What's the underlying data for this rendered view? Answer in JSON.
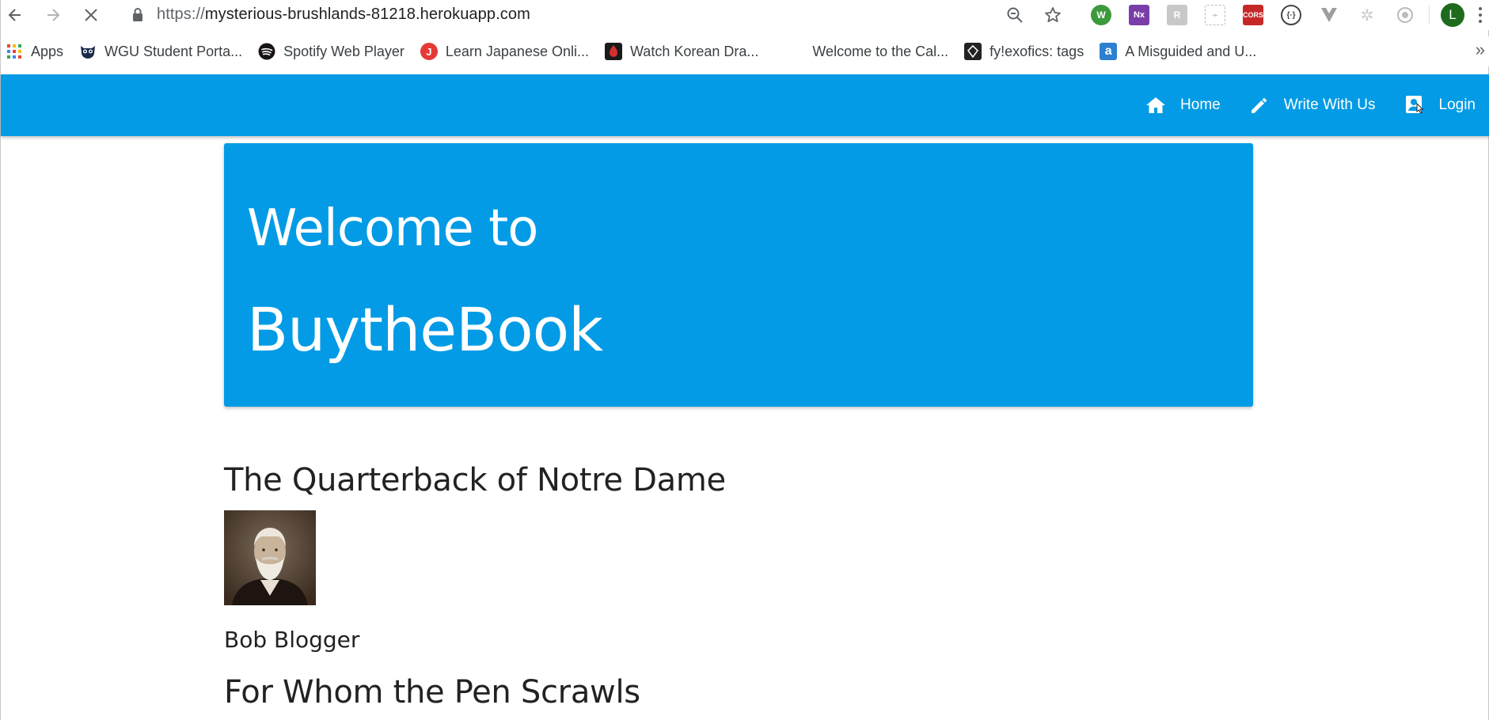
{
  "browser": {
    "url_scheme": "https://",
    "url_domain": "mysterious-brushlands-81218.herokuapp.com",
    "bookmarks": [
      {
        "label": "Apps",
        "icon": "apps-grid-icon"
      },
      {
        "label": "WGU Student Porta...",
        "icon": "owl-icon"
      },
      {
        "label": "Spotify Web Player",
        "icon": "spotify-icon"
      },
      {
        "label": "Learn Japanese Onli...",
        "icon": "japanese-site-icon"
      },
      {
        "label": "Watch Korean Dra...",
        "icon": "drama-site-icon"
      },
      {
        "label": "Welcome to the Cal...",
        "icon": ""
      },
      {
        "label": "fy!exofics: tags",
        "icon": "diamond-icon"
      },
      {
        "label": "A Misguided and U...",
        "icon": "a-letter-icon"
      }
    ],
    "avatar_letter": "L",
    "extension_labels": {
      "onenote": "Nx",
      "cors": "CORS"
    }
  },
  "nav": {
    "home": "Home",
    "write": "Write With Us",
    "login": "Login"
  },
  "hero": {
    "line1": "Welcome to",
    "line2": "BuytheBook"
  },
  "posts": [
    {
      "title": "The Quarterback of Notre Dame",
      "author": "Bob Blogger"
    },
    {
      "title": "For Whom the Pen Scrawls"
    }
  ],
  "colors": {
    "brand": "#039be5",
    "text": "#222222"
  }
}
